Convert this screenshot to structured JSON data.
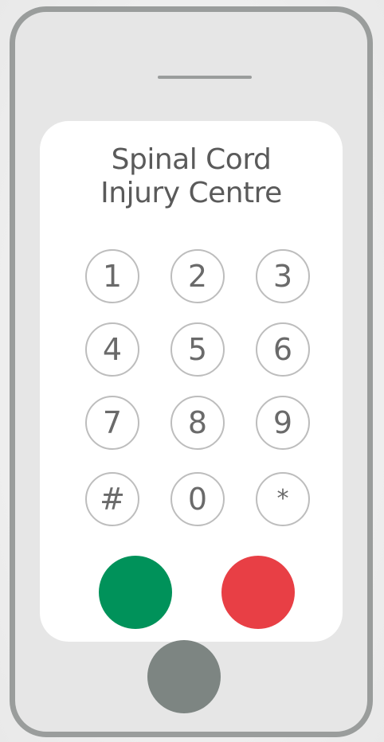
{
  "title": {
    "line1": "Spinal Cord",
    "line2": "Injury Centre"
  },
  "keypad": {
    "keys": [
      {
        "label": "1",
        "name": "key-1"
      },
      {
        "label": "2",
        "name": "key-2"
      },
      {
        "label": "3",
        "name": "key-3"
      },
      {
        "label": "4",
        "name": "key-4"
      },
      {
        "label": "5",
        "name": "key-5"
      },
      {
        "label": "6",
        "name": "key-6"
      },
      {
        "label": "7",
        "name": "key-7"
      },
      {
        "label": "8",
        "name": "key-8"
      },
      {
        "label": "9",
        "name": "key-9"
      },
      {
        "label": "#",
        "name": "key-hash"
      },
      {
        "label": "0",
        "name": "key-0"
      },
      {
        "label": "*",
        "name": "key-star"
      }
    ]
  },
  "buttons": {
    "call_color": "#00925a",
    "end_color": "#e83f45",
    "home_color": "#7d8582"
  }
}
